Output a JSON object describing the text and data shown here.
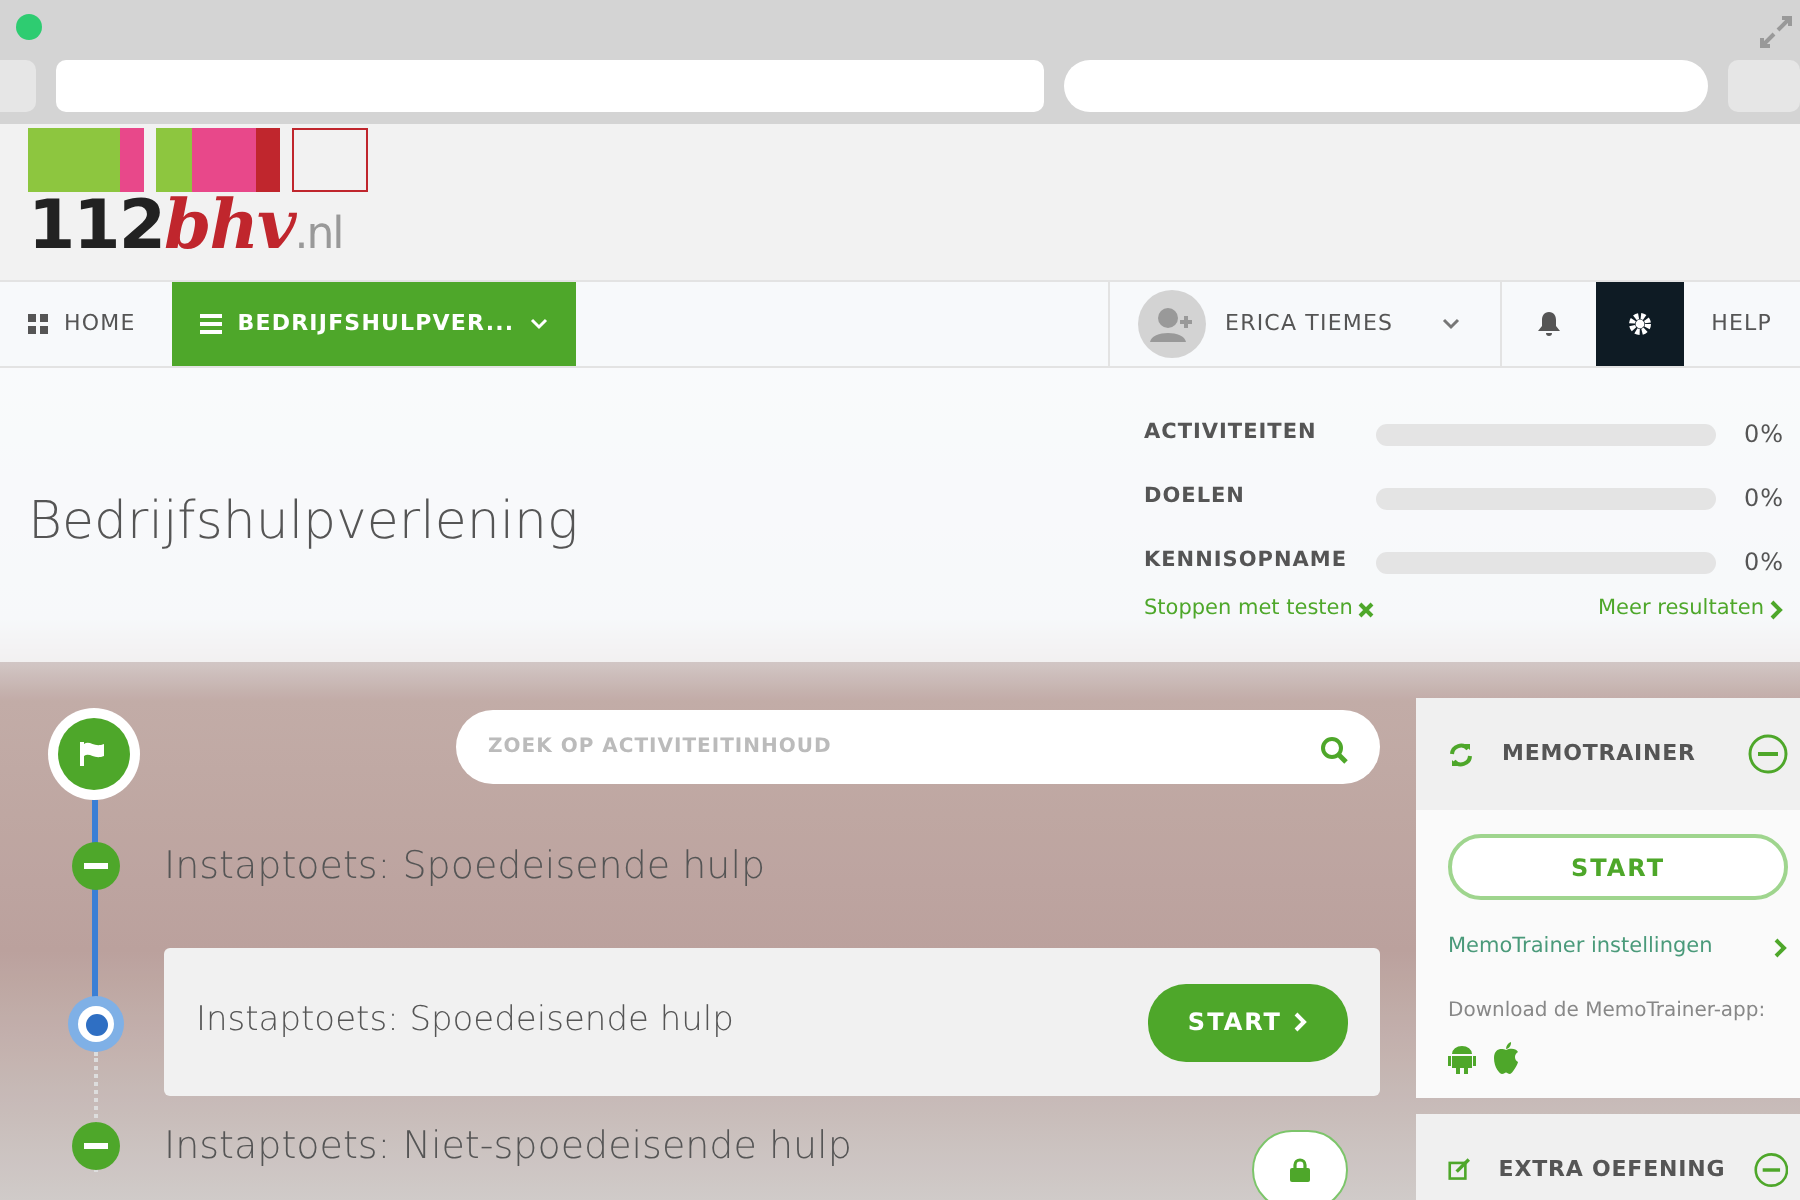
{
  "logo": {
    "number": "112",
    "accent": "bhv",
    "suffix": ".nl"
  },
  "nav": {
    "items": [
      {
        "kind": "home",
        "label": "HOME",
        "selected": false
      },
      {
        "kind": "menu",
        "label": "BEDRIJFSHULPVER...",
        "selected": true
      }
    ],
    "user": "ERICA TIEMES",
    "help": "HELP"
  },
  "header": {
    "title": "Bedrijfshulpverlening",
    "progress": [
      {
        "label": "ACTIVITEITEN",
        "level": 0,
        "reading": "0%"
      },
      {
        "label": "DOELEN",
        "level": 0,
        "reading": "0%"
      },
      {
        "label": "KENNISOPNAME",
        "level": 0,
        "reading": "0%"
      }
    ],
    "stop_link": "Stoppen met testen",
    "more_link": "Meer resultaten"
  },
  "search": {
    "placeholder": "ZOEK OP ACTIVITEITINHOUD"
  },
  "timeline": [
    {
      "kind": "section",
      "title": "Instaptoets: Spoedeisende hulp",
      "locked": false
    },
    {
      "kind": "activity",
      "title": "Instaptoets: Spoedeisende hulp",
      "button": "START"
    },
    {
      "kind": "section",
      "title": "Instaptoets: Niet-spoedeisende hulp",
      "locked": true
    }
  ],
  "panels": [
    {
      "kind": "memotrainer",
      "title": "MEMOTRAINER",
      "expanded": true,
      "button": "START",
      "settings_link": "MemoTrainer instellingen",
      "download_text": "Download de MemoTrainer-app:"
    },
    {
      "kind": "exercise",
      "title": "EXTRA OEFENING",
      "expanded": true
    }
  ]
}
